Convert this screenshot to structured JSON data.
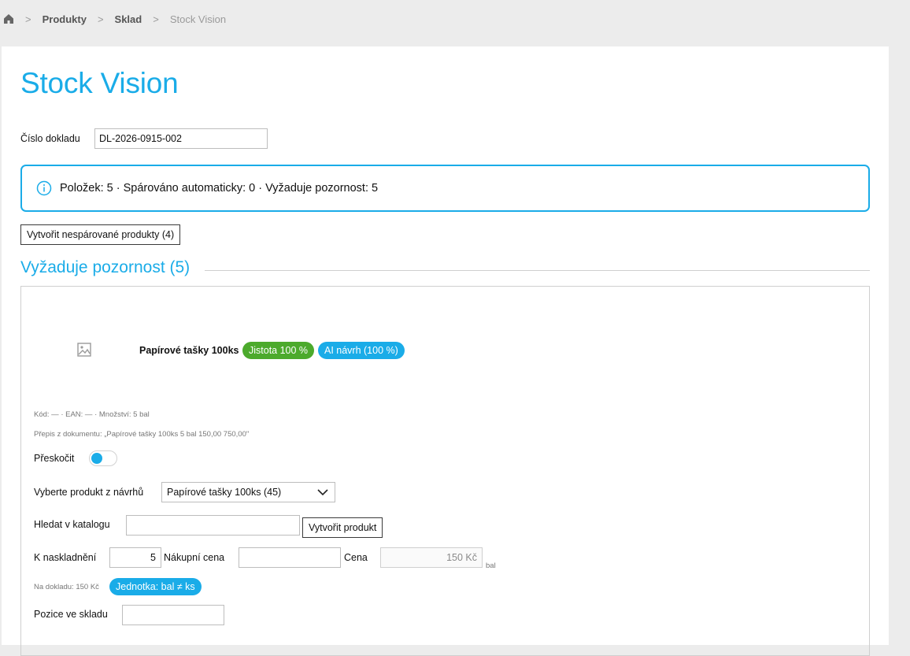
{
  "breadcrumb": {
    "home_icon": "home-icon",
    "items": [
      "Produkty",
      "Sklad"
    ],
    "current": "Stock Vision"
  },
  "page": {
    "title": "Stock Vision",
    "doc_number_label": "Číslo dokladu",
    "doc_number_value": "DL-2026-0915-002"
  },
  "info": {
    "icon": "info-icon",
    "text": "Položek: 5 · Spárováno automaticky: 0 · Vyžaduje pozornost: 5"
  },
  "actions": {
    "create_unmatched": "Vytvořit nespárované produkty (4)"
  },
  "section": {
    "title": "Vyžaduje pozornost (5)"
  },
  "item": {
    "image_icon": "image-placeholder-icon",
    "name": "Papírové tašky 100ks",
    "confidence_badge": "Jistota 100 %",
    "ai_badge": "AI návrh (100 %)",
    "meta_line": "Kód: — · EAN: — · Množství: 5 bal",
    "transcript": "Přepis z dokumentu: „Papírové tašky 100ks 5 bal 150,00 750,00\"",
    "skip_label": "Přeskočit",
    "skip_on": true,
    "suggestion_label": "Vyberte produkt z návrhů",
    "suggestion_value": "Papírové tašky 100ks (45)",
    "catalog_search_label": "Hledat v katalogu",
    "catalog_search_value": "",
    "create_product_label": "Vytvořit produkt",
    "stock_in_label": "K naskladnění",
    "stock_in_value": "5",
    "purchase_price_label": "Nákupní cena",
    "purchase_price_value": "",
    "price_label": "Cena",
    "price_value": "150 Kč",
    "price_unit": "bal",
    "doc_price_note": "Na dokladu: 150 Kč",
    "unit_badge": "Jednotka: bal ≠ ks",
    "location_label": "Pozice ve skladu",
    "location_value": ""
  },
  "colors": {
    "accent": "#1aace8",
    "success": "#4caa2c",
    "background": "#ececec"
  }
}
